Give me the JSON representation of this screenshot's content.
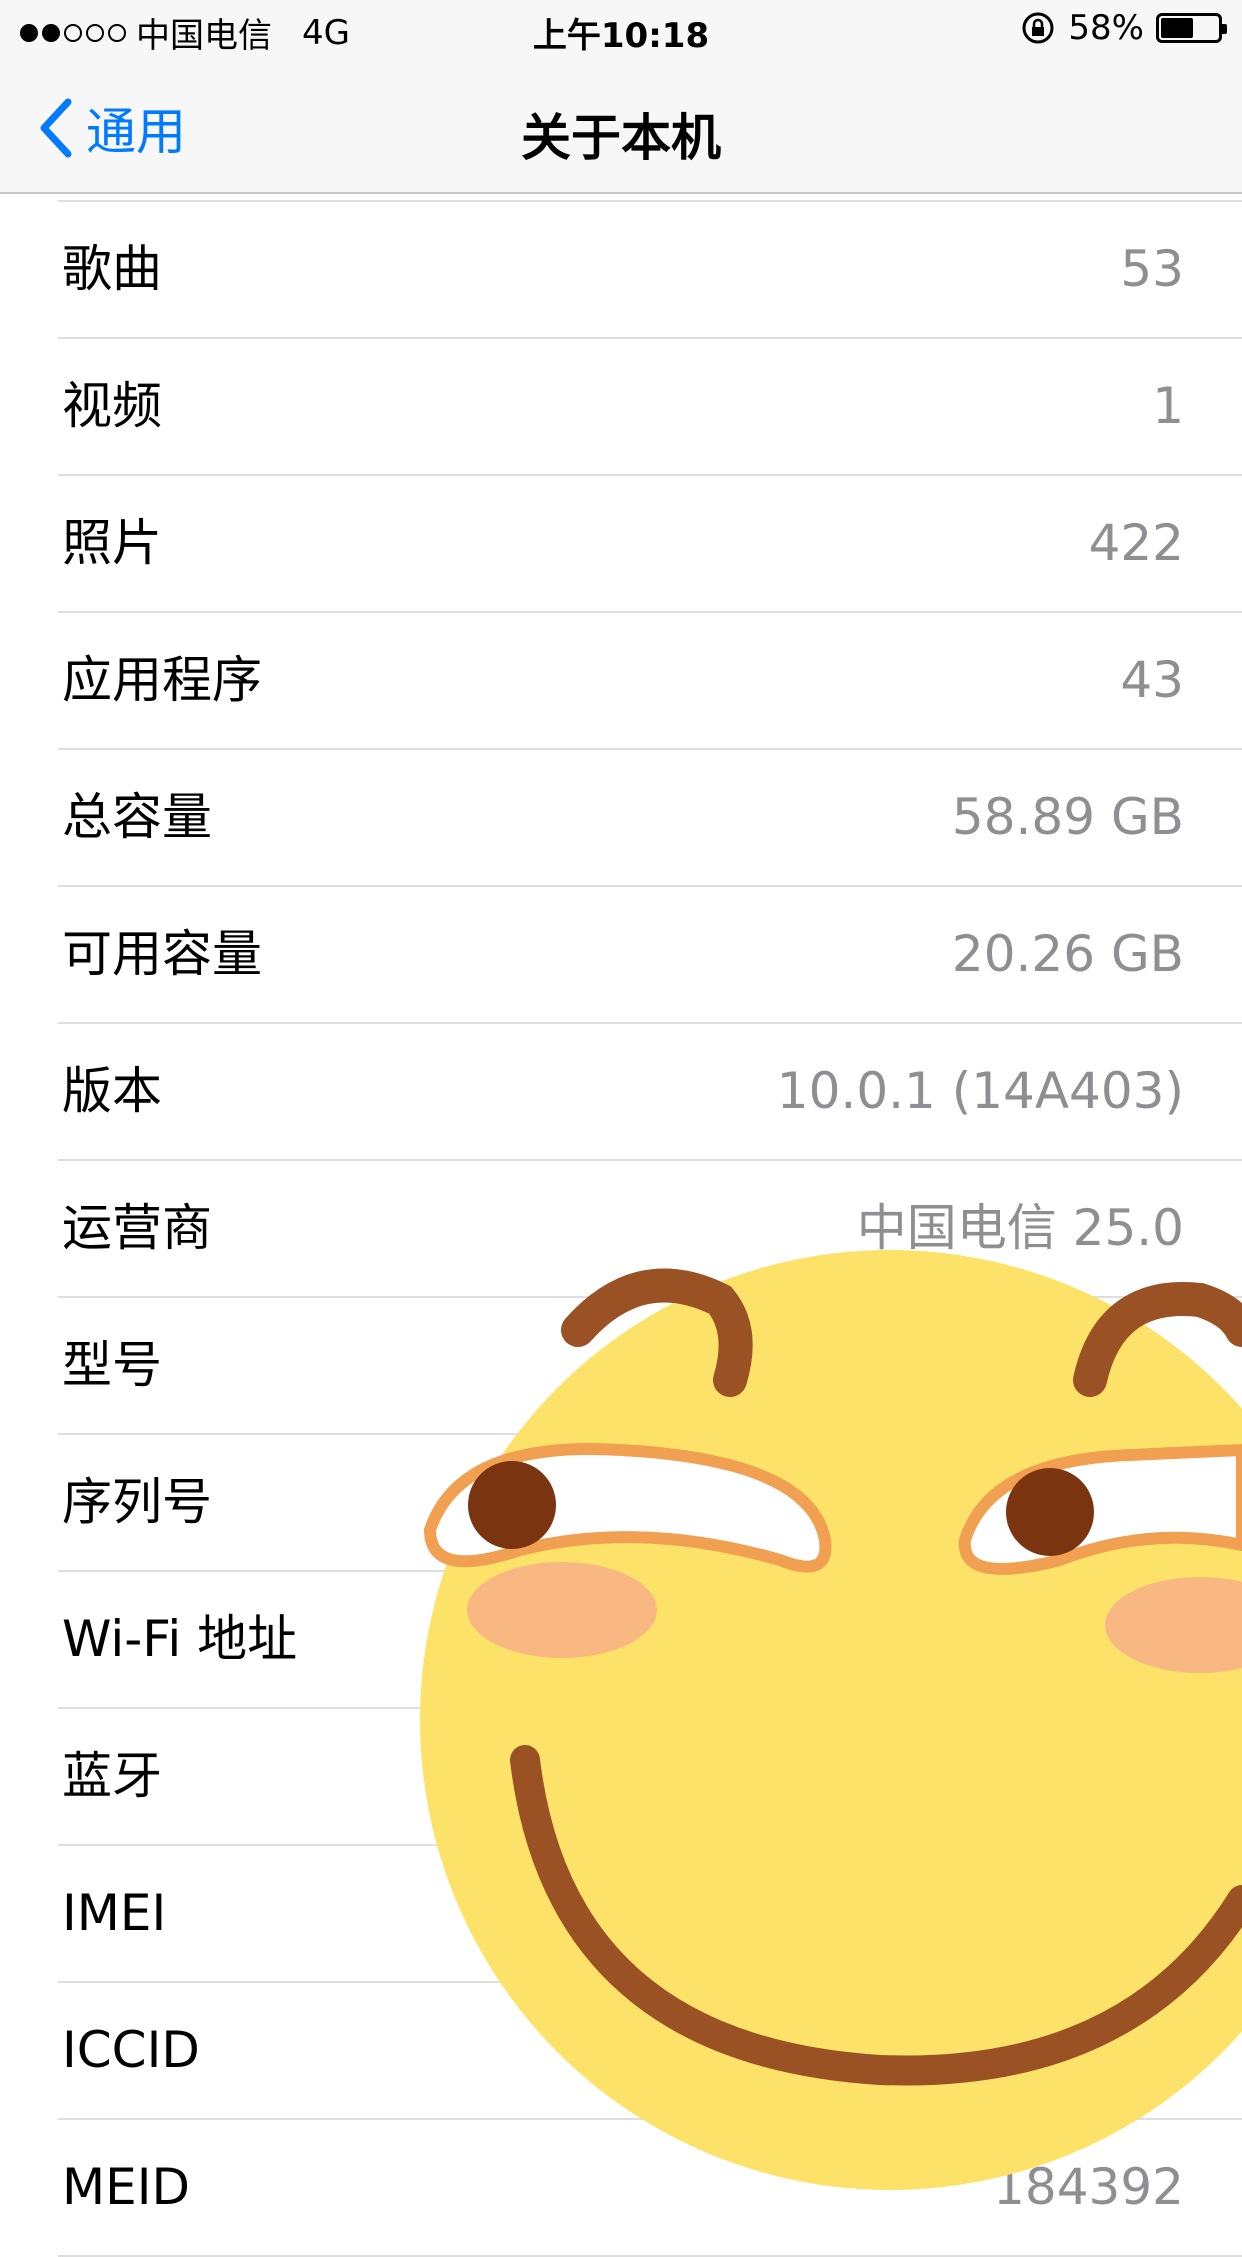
{
  "status_bar": {
    "carrier": "中国电信",
    "network": "4G",
    "time": "上午10:18",
    "battery": "58%",
    "battery_level": 0.58,
    "signal_bars": 2,
    "signal_total": 5
  },
  "nav": {
    "back_label": "通用",
    "title": "关于本机"
  },
  "rows": [
    {
      "label": "歌曲",
      "value": "53"
    },
    {
      "label": "视频",
      "value": "1"
    },
    {
      "label": "照片",
      "value": "422"
    },
    {
      "label": "应用程序",
      "value": "43"
    },
    {
      "label": "总容量",
      "value": "58.89 GB"
    },
    {
      "label": "可用容量",
      "value": "20.26 GB"
    },
    {
      "label": "版本",
      "value": "10.0.1 (14A403)"
    },
    {
      "label": "运营商",
      "value": "中国电信 25.0"
    },
    {
      "label": "型号",
      "value": ""
    },
    {
      "label": "序列号",
      "value": ""
    },
    {
      "label": "Wi-Fi 地址",
      "value": ""
    },
    {
      "label": "蓝牙",
      "value": ""
    },
    {
      "label": "IMEI",
      "value": ""
    },
    {
      "label": "ICCID",
      "value": ""
    },
    {
      "label": "MEID",
      "value": "184392"
    }
  ],
  "colors": {
    "accent": "#007aff",
    "emoji_face": "#fde26a",
    "emoji_brown": "#9a5224",
    "emoji_orange": "#f0a050"
  }
}
